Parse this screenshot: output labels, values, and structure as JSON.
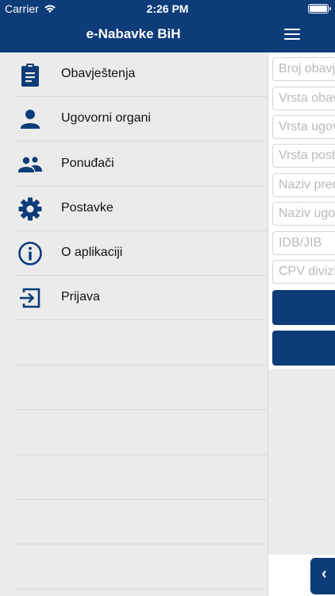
{
  "status_bar": {
    "carrier": "Carrier",
    "time": "2:26 PM"
  },
  "header": {
    "title": "e-Nabavke BiH"
  },
  "drawer": {
    "items": [
      {
        "label": "Obavještenja",
        "icon": "clipboard-icon"
      },
      {
        "label": "Ugovorni organi",
        "icon": "person-icon"
      },
      {
        "label": "Ponuđači",
        "icon": "people-icon"
      },
      {
        "label": "Postavke",
        "icon": "gear-icon"
      },
      {
        "label": "O aplikaciji",
        "icon": "info-icon"
      },
      {
        "label": "Prijava",
        "icon": "login-icon"
      }
    ]
  },
  "form": {
    "placeholders": [
      "Broj obavještenja",
      "Vrsta obavještenja",
      "Vrsta ugovora",
      "Vrsta postupka",
      "Naziv predmeta",
      "Naziv ugovornog organa",
      "IDB/JIB",
      "CPV divizija"
    ]
  },
  "colors": {
    "primary": "#0d3c79",
    "drawer_bg": "#ebebeb"
  }
}
